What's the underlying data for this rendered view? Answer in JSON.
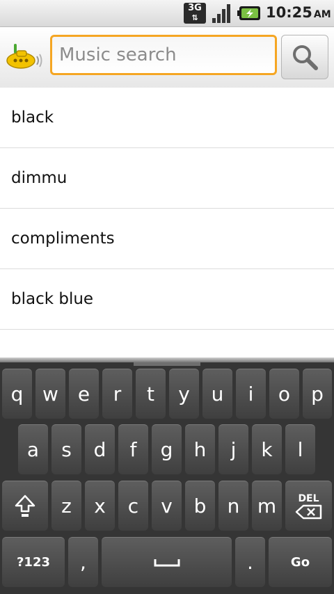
{
  "status_bar": {
    "network": "3G",
    "time": "10:25",
    "ampm": "AM"
  },
  "search": {
    "placeholder": "Music search",
    "value": ""
  },
  "suggestions": [
    "black",
    "dimmu",
    "compliments",
    "black blue"
  ],
  "keyboard": {
    "row1": [
      "q",
      "w",
      "e",
      "r",
      "t",
      "y",
      "u",
      "i",
      "o",
      "p"
    ],
    "row2": [
      "a",
      "s",
      "d",
      "f",
      "g",
      "h",
      "j",
      "k",
      "l"
    ],
    "row3": [
      "z",
      "x",
      "c",
      "v",
      "b",
      "n",
      "m"
    ],
    "delete_label": "DEL",
    "symbols_label": "?123",
    "comma_label": ",",
    "period_label": ".",
    "go_label": "Go"
  }
}
